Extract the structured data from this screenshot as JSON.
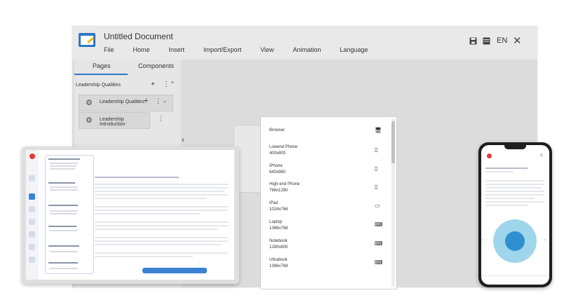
{
  "editor": {
    "title": "Untitled Document",
    "menu": [
      "File",
      "Home",
      "Insert",
      "Import/Export",
      "View",
      "Animation",
      "Language"
    ],
    "language": "EN",
    "icons": {
      "save": "save-icon",
      "layout": "layout-icon",
      "close": "close-icon"
    }
  },
  "left_panel": {
    "tabs": [
      "Pages",
      "Components"
    ],
    "active_tab": "Pages",
    "section_title": "Leadership Qualities",
    "pages": [
      "Leadership Qualities",
      "Leadership Introduction"
    ]
  },
  "devices": [
    {
      "name": "Browser",
      "size": "",
      "icon": "monitor-icon"
    },
    {
      "name": "Lowend Phone",
      "size": "400x800",
      "icon": "phone-icon"
    },
    {
      "name": "iPhone",
      "size": "640x960",
      "icon": "phone-icon"
    },
    {
      "name": "High-end Phone",
      "size": "768x1280",
      "icon": "phone-icon"
    },
    {
      "name": "iPad",
      "size": "1024x768",
      "icon": "tablet-icon"
    },
    {
      "name": "Laptop",
      "size": "1366x768",
      "icon": "laptop-icon"
    },
    {
      "name": "Notebook",
      "size": "1280x800",
      "icon": "laptop-icon"
    },
    {
      "name": "Ultrabook",
      "size": "1366x768",
      "icon": "laptop-icon"
    }
  ],
  "colors": {
    "accent": "#2f78c4",
    "logo": "#e53935"
  }
}
